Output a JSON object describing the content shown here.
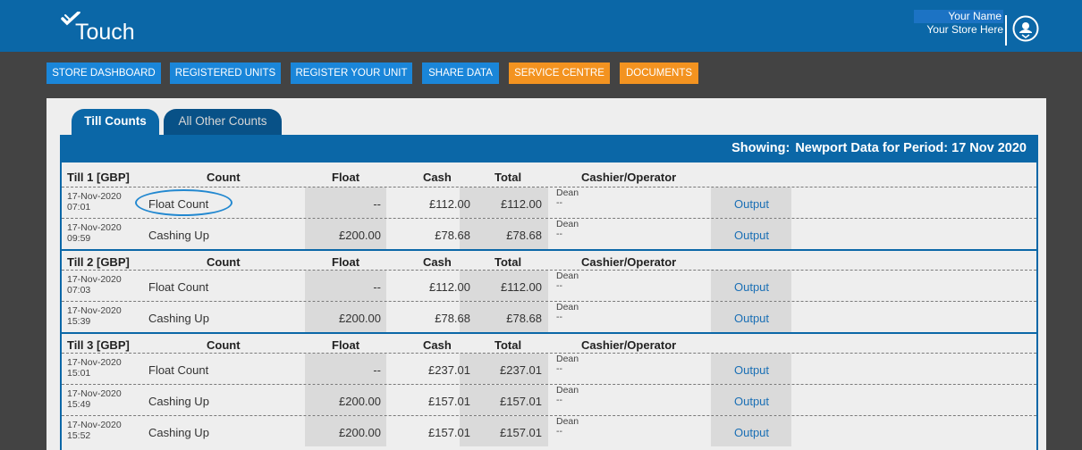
{
  "header": {
    "logo_text": "Touch",
    "user_name": "Your Name",
    "store_name": "Your Store Here"
  },
  "nav": [
    {
      "label": "STORE DASHBOARD",
      "color": "#1a86d9"
    },
    {
      "label": "REGISTERED UNITS",
      "color": "#1a86d9"
    },
    {
      "label": "REGISTER YOUR UNIT",
      "color": "#1a86d9"
    },
    {
      "label": "SHARE DATA",
      "color": "#1a86d9"
    },
    {
      "label": "SERVICE CENTRE",
      "color": "#f39320"
    },
    {
      "label": "DOCUMENTS",
      "color": "#f39320"
    }
  ],
  "tabs": {
    "active": "Till Counts",
    "inactive": "All Other Counts"
  },
  "showing": {
    "label": "Showing:",
    "text": "Newport Data for Period: 17 Nov 2020"
  },
  "columns": {
    "count": "Count",
    "float": "Float",
    "cash": "Cash",
    "total": "Total",
    "operator": "Cashier/Operator"
  },
  "tills": [
    {
      "name": "Till 1 [GBP]",
      "rows": [
        {
          "date": "17-Nov-2020",
          "time": "07:01",
          "count": "Float Count",
          "float": "--",
          "cash": "£112.00",
          "total": "£112.00",
          "operator": "Dean",
          "operator_sub": "--",
          "action": "Output"
        },
        {
          "date": "17-Nov-2020",
          "time": "09:59",
          "count": "Cashing Up",
          "float": "£200.00",
          "cash": "£78.68",
          "total": "£78.68",
          "operator": "Dean",
          "operator_sub": "--",
          "action": "Output"
        }
      ]
    },
    {
      "name": "Till 2 [GBP]",
      "rows": [
        {
          "date": "17-Nov-2020",
          "time": "07:03",
          "count": "Float Count",
          "float": "--",
          "cash": "£112.00",
          "total": "£112.00",
          "operator": "Dean",
          "operator_sub": "--",
          "action": "Output"
        },
        {
          "date": "17-Nov-2020",
          "time": "15:39",
          "count": "Cashing Up",
          "float": "£200.00",
          "cash": "£78.68",
          "total": "£78.68",
          "operator": "Dean",
          "operator_sub": "--",
          "action": "Output"
        }
      ]
    },
    {
      "name": "Till 3 [GBP]",
      "rows": [
        {
          "date": "17-Nov-2020",
          "time": "15:01",
          "count": "Float Count",
          "float": "--",
          "cash": "£237.01",
          "total": "£237.01",
          "operator": "Dean",
          "operator_sub": "--",
          "action": "Output"
        },
        {
          "date": "17-Nov-2020",
          "time": "15:49",
          "count": "Cashing Up",
          "float": "£200.00",
          "cash": "£157.01",
          "total": "£157.01",
          "operator": "Dean",
          "operator_sub": "--",
          "action": "Output"
        },
        {
          "date": "17-Nov-2020",
          "time": "15:52",
          "count": "Cashing Up",
          "float": "£200.00",
          "cash": "£157.01",
          "total": "£157.01",
          "operator": "Dean",
          "operator_sub": "--",
          "action": "Output"
        }
      ]
    }
  ]
}
